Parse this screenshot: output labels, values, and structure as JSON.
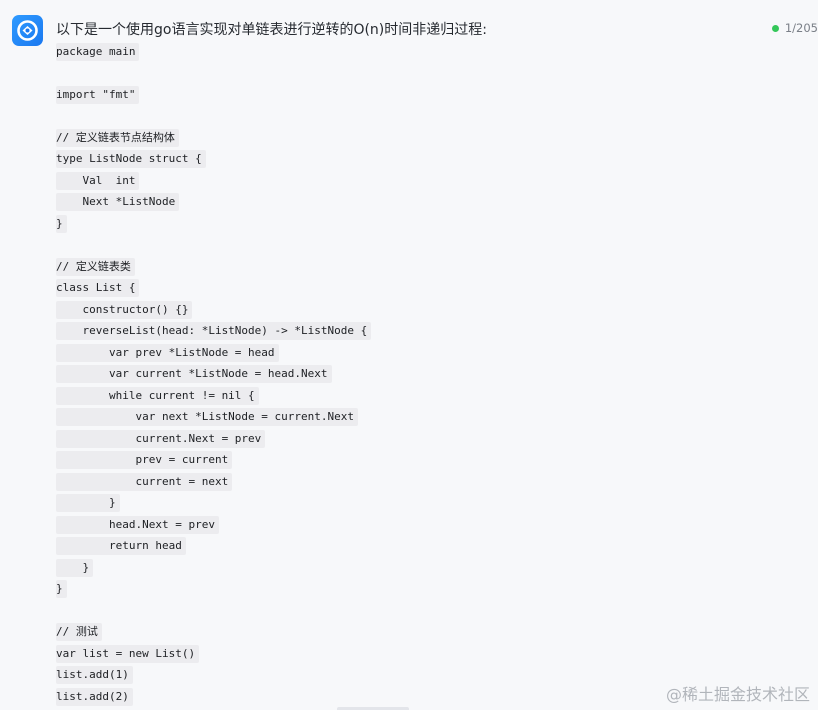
{
  "message": {
    "avatar_icon": "assistant-logo-icon",
    "header_text": "以下是一个使用go语言实现对单链表进行逆转的O(n)时间非递归过程:",
    "status_text": "1/205",
    "status_color": "#34c759"
  },
  "code": {
    "lines": [
      "package main",
      "",
      "import \"fmt\"",
      "",
      "// 定义链表节点结构体",
      "type ListNode struct {",
      "    Val  int",
      "    Next *ListNode",
      "}",
      "",
      "// 定义链表类",
      "class List {",
      "    constructor() {}",
      "    reverseList(head: *ListNode) -> *ListNode {",
      "        var prev *ListNode = head",
      "        var current *ListNode = head.Next",
      "        while current != nil {",
      "            var next *ListNode = current.Next",
      "            current.Next = prev",
      "            prev = current",
      "            current = next",
      "        }",
      "        head.Next = prev",
      "        return head",
      "    }",
      "}",
      "",
      "// 测试",
      "var list = new List()",
      "list.add(1)",
      "list.add(2)"
    ]
  },
  "watermark": {
    "text": "@稀土掘金技术社区"
  }
}
